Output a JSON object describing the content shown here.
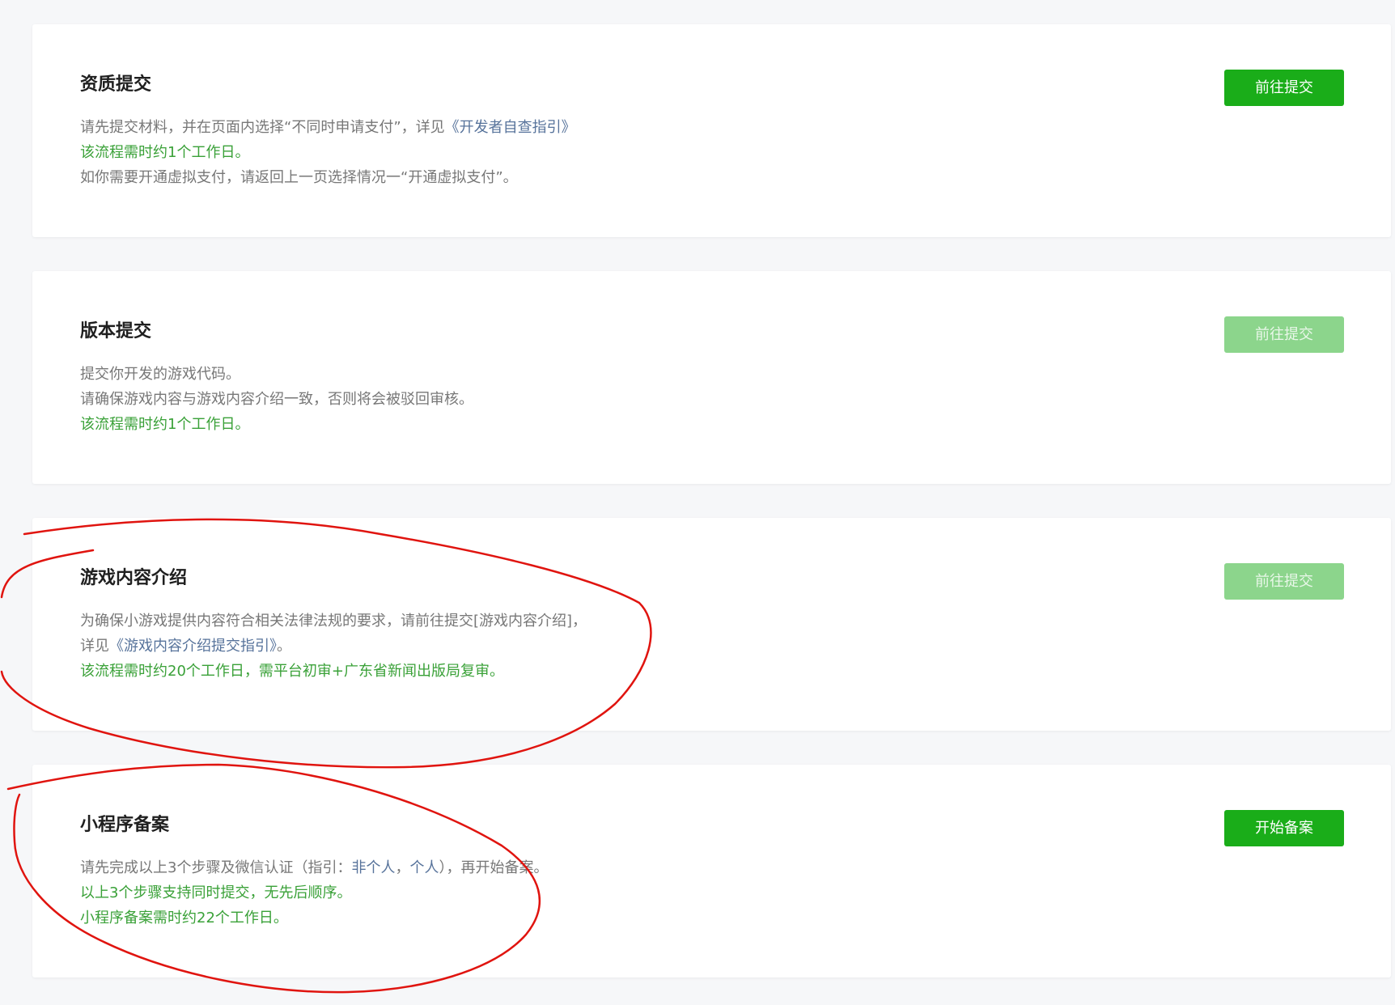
{
  "cards": [
    {
      "title": "资质提交",
      "button": {
        "label": "前往提交",
        "enabled": true
      },
      "lines": [
        {
          "t1": "请先提交材料，并在页面内选择“不同时申请支付”，详见",
          "link": "《开发者自查指引》"
        },
        {
          "green": "该流程需时约1个工作日。"
        },
        {
          "t1": "如你需要开通虚拟支付，请返回上一页选择情况一“开通虚拟支付”。"
        }
      ]
    },
    {
      "title": "版本提交",
      "button": {
        "label": "前往提交",
        "enabled": false
      },
      "lines": [
        {
          "t1": "提交你开发的游戏代码。"
        },
        {
          "t1": "请确保游戏内容与游戏内容介绍一致，否则将会被驳回审核。"
        },
        {
          "green": "该流程需时约1个工作日。"
        }
      ]
    },
    {
      "title": "游戏内容介绍",
      "button": {
        "label": "前往提交",
        "enabled": false
      },
      "lines": [
        {
          "t1": "为确保小游戏提供内容符合相关法律法规的要求，请前往提交[游戏内容介绍]，"
        },
        {
          "t1": "详见",
          "link": "《游戏内容介绍提交指引》",
          "t2": "。"
        },
        {
          "green": "该流程需时约20个工作日，需平台初审+广东省新闻出版局复审。"
        }
      ]
    },
    {
      "title": "小程序备案",
      "button": {
        "label": "开始备案",
        "enabled": true
      },
      "lines": [
        {
          "t1": "请先完成以上3个步骤及微信认证（指引：",
          "link": "非个人",
          "t2": "，",
          "link2": "个人",
          "t3": "），再开始备案。"
        },
        {
          "green": "以上3个步骤支持同时提交，无先后顺序。"
        },
        {
          "green": "小程序备案需时约22个工作日。"
        }
      ]
    }
  ],
  "colors": {
    "primary_button": "#1aad19",
    "disabled_button": "#8cd58c",
    "green_text": "#3aa138",
    "link_text": "#57739b",
    "annotation_stroke": "#e0140f"
  }
}
